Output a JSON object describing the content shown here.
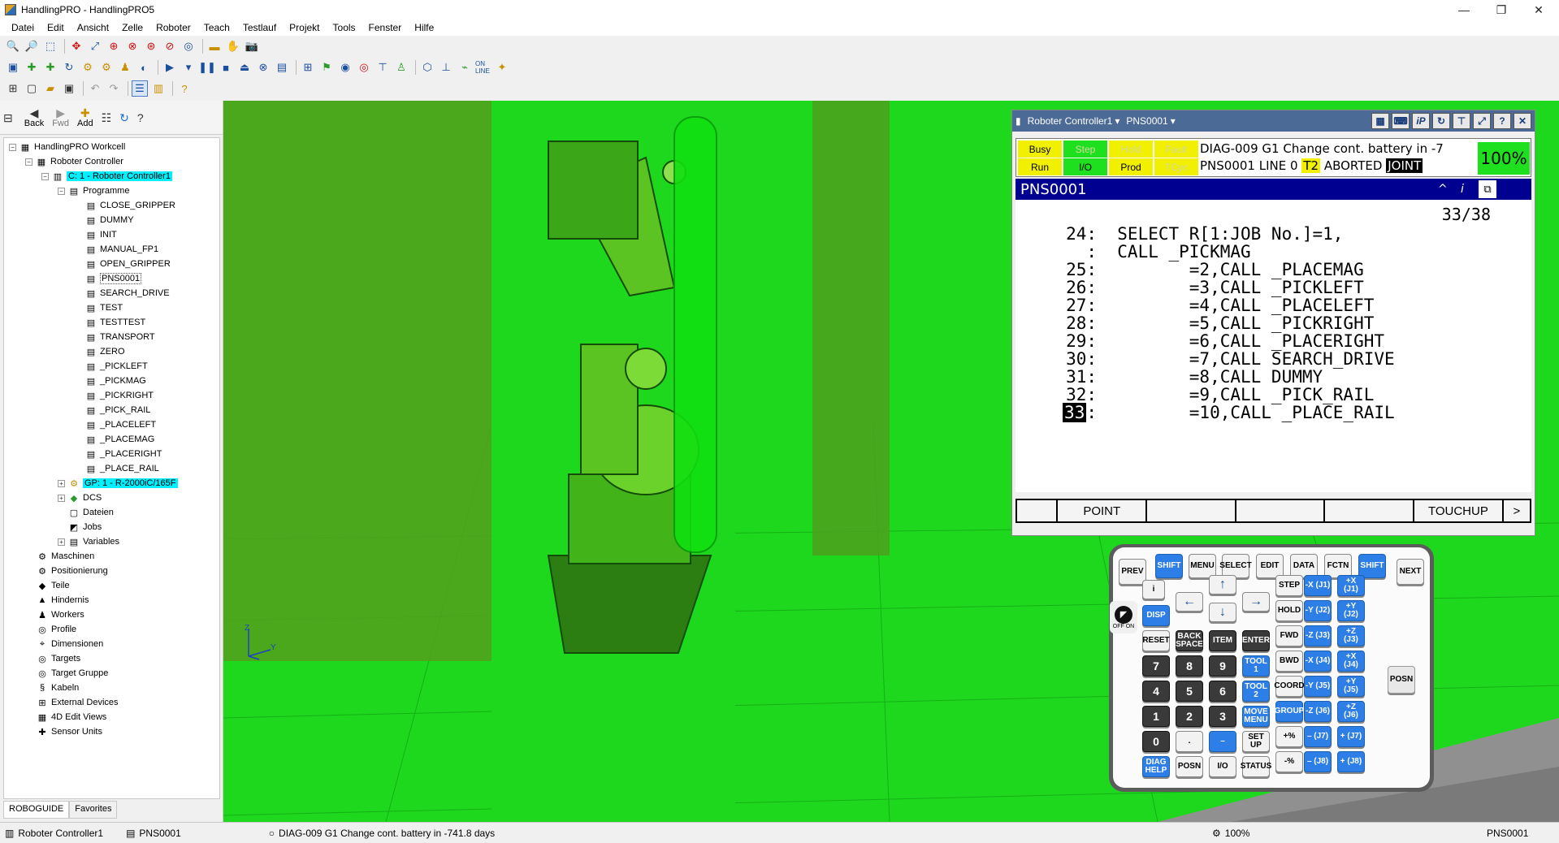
{
  "window": {
    "title": "HandlingPRO - HandlingPRO5",
    "minimize": "—",
    "maximize": "❐",
    "close": "✕"
  },
  "menu": [
    "Datei",
    "Edit",
    "Ansicht",
    "Zelle",
    "Roboter",
    "Teach",
    "Testlauf",
    "Projekt",
    "Tools",
    "Fenster",
    "Hilfe"
  ],
  "nav": {
    "back": "Back",
    "fwd": "Fwd",
    "add": "Add"
  },
  "tree": {
    "workcell": "HandlingPRO Workcell",
    "controller_group": "Roboter Controller",
    "controller": "C: 1 - Roboter Controller1",
    "programs_label": "Programme",
    "programs": [
      "CLOSE_GRIPPER",
      "DUMMY",
      "INIT",
      "MANUAL_FP1",
      "OPEN_GRIPPER",
      "PNS0001",
      "SEARCH_DRIVE",
      "TEST",
      "TESTTEST",
      "TRANSPORT",
      "ZERO",
      "_PICKLEFT",
      "_PICKMAG",
      "_PICKRIGHT",
      "_PICK_RAIL",
      "_PLACELEFT",
      "_PLACEMAG",
      "_PLACERIGHT",
      "_PLACE_RAIL"
    ],
    "gp": "GP: 1 - R-2000iC/165F",
    "controller_children": [
      "DCS",
      "Dateien",
      "Jobs",
      "Variables"
    ],
    "root_items": [
      "Maschinen",
      "Positionierung",
      "Teile",
      "Hindernis",
      "Workers",
      "Profile",
      "Dimensionen",
      "Targets",
      "Target Gruppe",
      "Kabeln",
      "External Devices",
      "4D Edit Views",
      "Sensor Units"
    ]
  },
  "bottom_tabs": [
    "ROBOGUIDE",
    "Favorites"
  ],
  "axes": {
    "z": "Z",
    "y": "Y"
  },
  "pendant": {
    "controller": "Roboter Controller1",
    "program": "PNS0001",
    "status_leds": [
      {
        "label": "Busy",
        "active": true
      },
      {
        "label": "Step",
        "active": false
      },
      {
        "label": "Hold",
        "active": false
      },
      {
        "label": "Fault",
        "active": false
      },
      {
        "label": "Run",
        "active": true
      },
      {
        "label": "I/O",
        "active": true
      },
      {
        "label": "Prod",
        "active": true
      },
      {
        "label": "TCyc",
        "active": false
      }
    ],
    "diag_line1": "DIAG-009 G1 Change cont. battery in  -7",
    "diag_line2_prefix": "PNS0001 LINE 0",
    "mode": "T2",
    "state": "ABORTED",
    "coord": "JOINT",
    "override": "100%",
    "prog_name": "PNS0001",
    "line_count": "33/38",
    "lines": [
      {
        "num": "24:",
        "code": "  SELECT R[1:JOB No.]=1,"
      },
      {
        "num": ":",
        "code": "  CALL _PICKMAG"
      },
      {
        "num": "25:",
        "code": "         =2,CALL _PLACEMAG"
      },
      {
        "num": "26:",
        "code": "         =3,CALL _PICKLEFT"
      },
      {
        "num": "27:",
        "code": "         =4,CALL _PLACELEFT"
      },
      {
        "num": "28:",
        "code": "         =5,CALL _PICKRIGHT"
      },
      {
        "num": "29:",
        "code": "         =6,CALL _PLACERIGHT"
      },
      {
        "num": "30:",
        "code": "         =7,CALL SEARCH_DRIVE"
      },
      {
        "num": "31:",
        "code": "         =8,CALL DUMMY"
      },
      {
        "num": "32:",
        "code": "         =9,CALL _PICK_RAIL"
      },
      {
        "num": "33",
        "code": "         =10,CALL _PLACE_RAIL",
        "current": true
      }
    ],
    "fkeys": [
      "",
      "POINT",
      "",
      "",
      "",
      "TOUCHUP",
      ">"
    ]
  },
  "keypad": {
    "row1": [
      "PREV",
      "SHIFT",
      "MENU",
      "SELECT",
      "EDIT",
      "DATA",
      "FCTN",
      "SHIFT",
      "NEXT"
    ],
    "posn_side": "POSN",
    "offon": "OFF ON",
    "keys": {
      "info": "i",
      "disp": "DISP",
      "reset": "RESET",
      "backspace": "BACK SPACE",
      "item": "ITEM",
      "enter": "ENTER",
      "step": "STEP",
      "hold": "HOLD",
      "fwd": "FWD",
      "bwd": "BWD",
      "coord": "COORD",
      "group": "GROUP",
      "tool1": "TOOL 1",
      "tool2": "TOOL 2",
      "move_menu": "MOVE MENU",
      "setup": "SET UP",
      "diag_help": "DIAG HELP",
      "posn": "POSN",
      "io": "I/O",
      "status": "STATUS",
      "plus_pct": "+%",
      "minus_pct": "-%",
      "dot": ".",
      "minus": "–"
    },
    "digits": [
      "7",
      "8",
      "9",
      "4",
      "5",
      "6",
      "1",
      "2",
      "3",
      "0"
    ],
    "jog": [
      "-X (J1)",
      "+X (J1)",
      "-Y (J2)",
      "+Y (J2)",
      "-Z (J3)",
      "+Z (J3)",
      "-X (J4)",
      "+X (J4)",
      "-Y (J5)",
      "+Y (J5)",
      "-Z (J6)",
      "+Z (J6)",
      "– (J7)",
      "+ (J7)",
      "– (J8)",
      "+ (J8)"
    ]
  },
  "status": {
    "controller": "Roboter Controller1",
    "program": "PNS0001",
    "diag": "DIAG-009 G1 Change cont. battery in  -741.8  days",
    "speed": "100%",
    "program_right": "PNS0001"
  },
  "colors": {
    "viewport": "#1ed81e",
    "pendant_header": "#4b6a95",
    "program_header": "#000090",
    "led_on": "#f0f000",
    "led_off": "#f0f000",
    "accent_blue": "#2d7ee6"
  }
}
